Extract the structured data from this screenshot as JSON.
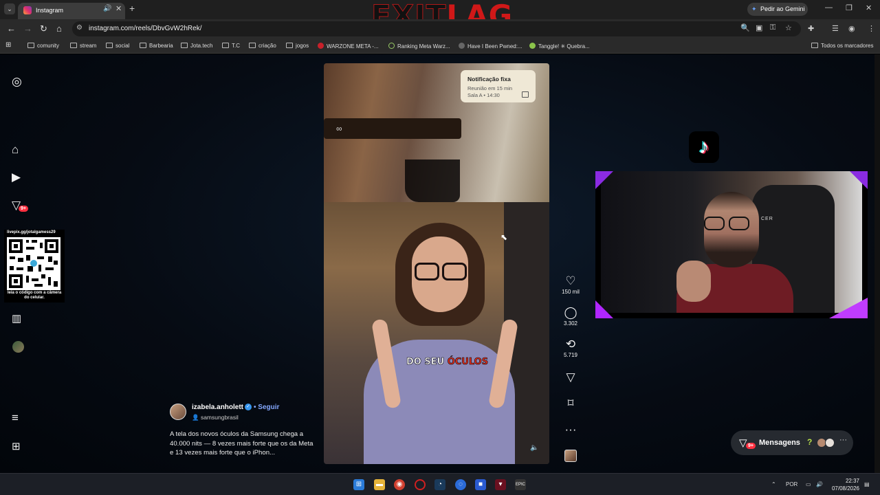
{
  "browser": {
    "tab_title": "Instagram",
    "url": "instagram.com/reels/DbvGvW2hRek/",
    "gemini_label": "Pedir ao Gemini",
    "overlay_logo": {
      "part1": "EXIT",
      "part2": "LAG"
    },
    "bookmarks": [
      "comunity",
      "stream",
      "social",
      "Barbearia",
      "Jota.tech",
      "T.C",
      "criação",
      "jogos",
      "WARZONE META -...",
      "Ranking Meta Warz...",
      "Have I Been Pwned:...",
      "Tanggle! ✳ Quebra..."
    ],
    "all_bookmarks": "Todos os marcadores"
  },
  "sidebar": {
    "notifications_badge": "9+",
    "qr": {
      "top_text": "livepix.gg/jotalgamess29",
      "bottom_text": "leia o código com a câmera do celular."
    }
  },
  "reel": {
    "notification": {
      "title": "Notificação fixa",
      "line1": "Reunião em 15 min",
      "line2": "Sala A • 14:30"
    },
    "caption_part1": "DO SEU ",
    "caption_part2": "ÓCULOS"
  },
  "actions": {
    "likes": "150 mil",
    "comments": "3.302",
    "reposts": "5.719"
  },
  "author": {
    "username": "izabela.anholett",
    "follow": "Seguir",
    "collab": "samsungbrasil",
    "description": "A tela dos novos óculos da Samsung chega a 40.000 nits — 8 vezes mais forte que os da Meta e 13 vezes mais forte que o iPhon..."
  },
  "messages": {
    "label": "Mensagens",
    "badge": "9+"
  },
  "taskbar": {
    "language": "POR",
    "time": "22:37",
    "date": "07/08/2026"
  },
  "colors": {
    "accent_blue": "#3897f0",
    "badge_red": "#ff3040",
    "exitlag_red": "#d01818"
  }
}
